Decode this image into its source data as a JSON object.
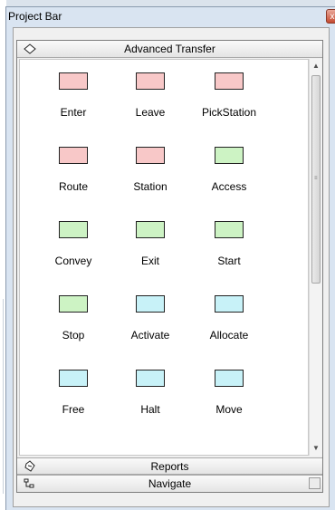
{
  "window": {
    "title": "Project Bar",
    "close_glyph": "x"
  },
  "panel": {
    "header": "Advanced Transfer",
    "header_icon": "diamond-icon",
    "colors": {
      "red": "#f8c8c8",
      "green": "#cdf3c4",
      "cyan": "#c8f2f8"
    },
    "modules": [
      {
        "label": "Enter",
        "color": "red"
      },
      {
        "label": "Leave",
        "color": "red"
      },
      {
        "label": "PickStation",
        "color": "red"
      },
      {
        "label": "Route",
        "color": "red"
      },
      {
        "label": "Station",
        "color": "red"
      },
      {
        "label": "Access",
        "color": "green"
      },
      {
        "label": "Convey",
        "color": "green"
      },
      {
        "label": "Exit",
        "color": "green"
      },
      {
        "label": "Start",
        "color": "green"
      },
      {
        "label": "Stop",
        "color": "green"
      },
      {
        "label": "Activate",
        "color": "cyan"
      },
      {
        "label": "Allocate",
        "color": "cyan"
      },
      {
        "label": "Free",
        "color": "cyan"
      },
      {
        "label": "Halt",
        "color": "cyan"
      },
      {
        "label": "Move",
        "color": "cyan"
      }
    ]
  },
  "sections": {
    "reports": {
      "label": "Reports",
      "icon": "reports-icon"
    },
    "navigate": {
      "label": "Navigate",
      "icon": "tree-icon"
    }
  }
}
